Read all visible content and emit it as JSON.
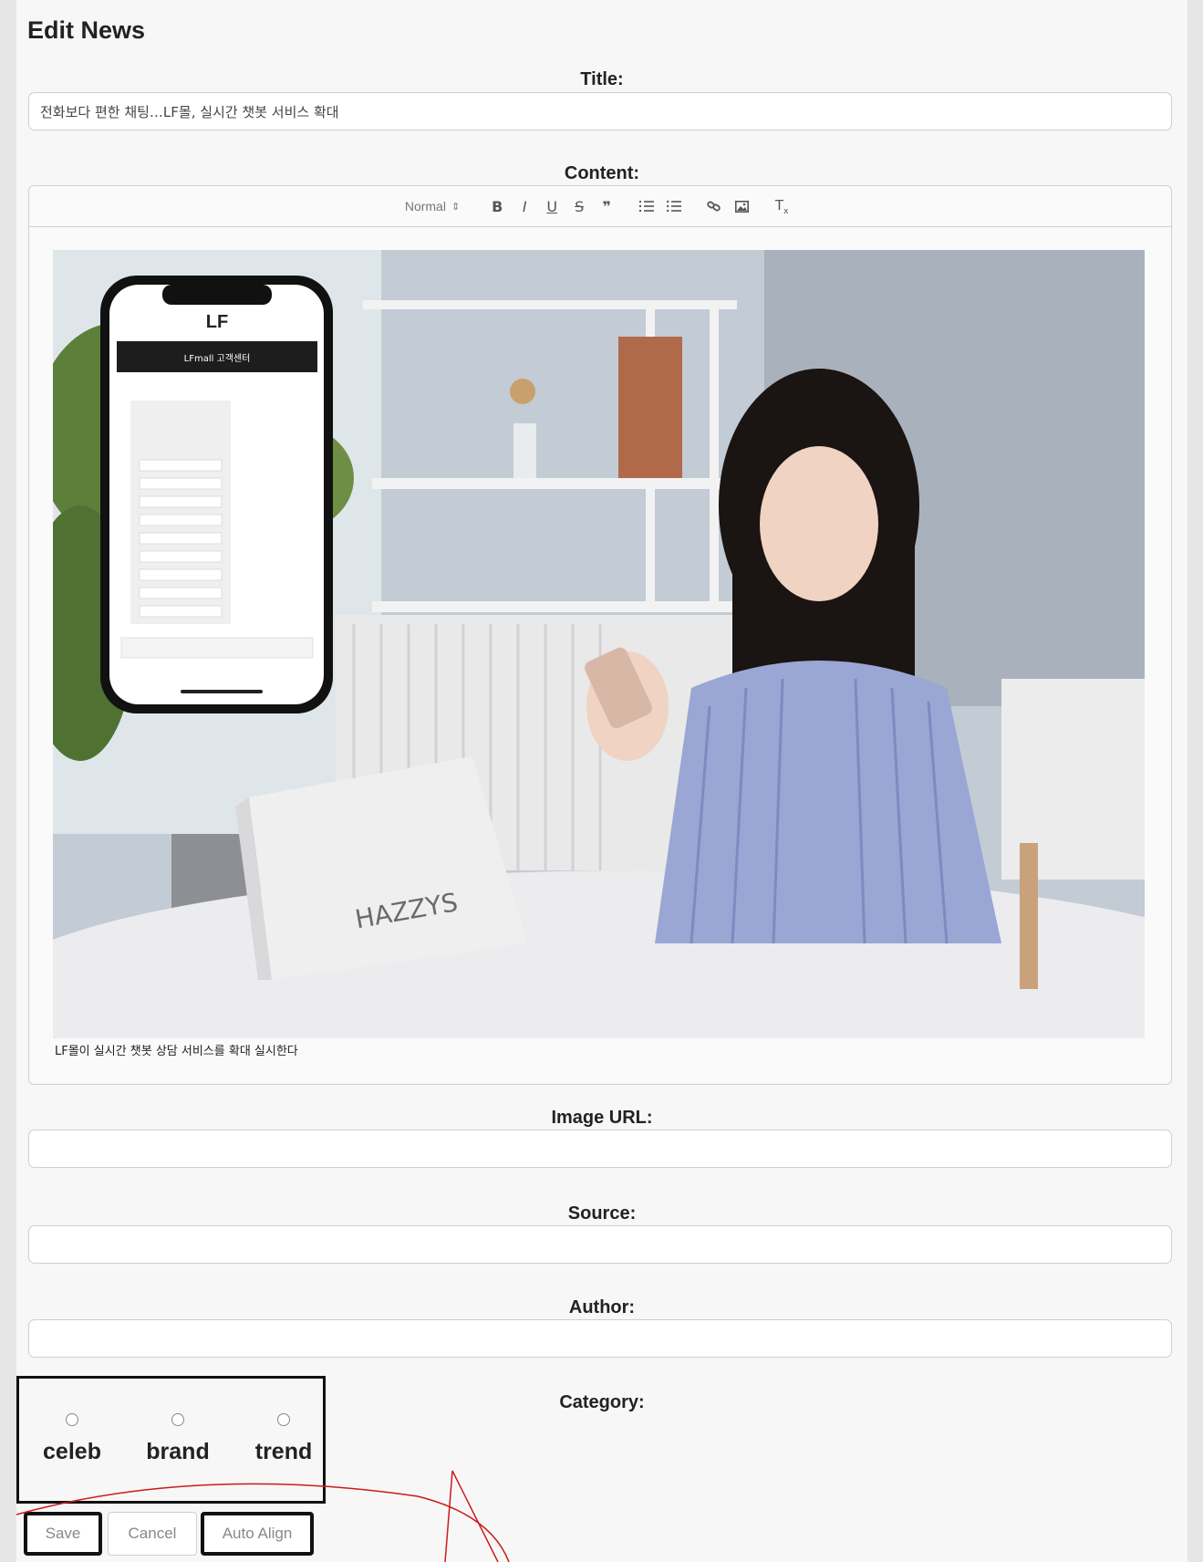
{
  "page": {
    "title": "Edit News"
  },
  "title_field": {
    "label": "Title:",
    "value": "전화보다 편한 채팅…LF몰, 실시간 챗봇 서비스 확대"
  },
  "content_field": {
    "label": "Content:",
    "toolbar": {
      "format_select": "Normal",
      "buttons": [
        {
          "name": "bold-button",
          "glyph": "B",
          "icon": "bold-icon"
        },
        {
          "name": "italic-button",
          "glyph": "I",
          "icon": "italic-icon"
        },
        {
          "name": "underline-button",
          "glyph": "U",
          "icon": "underline-icon"
        },
        {
          "name": "strike-button",
          "glyph": "S",
          "icon": "strikethrough-icon"
        },
        {
          "name": "blockquote-button",
          "glyph": "❞",
          "icon": "quote-icon"
        },
        {
          "name": "ordered-list-button",
          "glyph": "☰",
          "icon": "ordered-list-icon"
        },
        {
          "name": "bullet-list-button",
          "glyph": "☰",
          "icon": "bullet-list-icon"
        },
        {
          "name": "link-button",
          "glyph": "🔗",
          "icon": "link-icon"
        },
        {
          "name": "image-button",
          "glyph": "▣",
          "icon": "image-icon"
        },
        {
          "name": "clear-format-button",
          "glyph": "Tx",
          "icon": "clear-format-icon"
        }
      ]
    },
    "image": {
      "phone_logo": "LF",
      "bag_brand": "HAZZYS",
      "phone_header": "LFmall 고객센터"
    },
    "caption": "LF몰이 실시간 챗봇 상담 서비스를 확대 실시한다"
  },
  "image_url_field": {
    "label": "Image URL:",
    "value": ""
  },
  "source_field": {
    "label": "Source:",
    "value": ""
  },
  "author_field": {
    "label": "Author:",
    "value": ""
  },
  "category_field": {
    "label": "Category:",
    "options": [
      "celeb",
      "brand",
      "trend"
    ]
  },
  "actions": {
    "save_label": "Save",
    "cancel_label": "Cancel",
    "auto_align_label": "Auto Align"
  },
  "colors": {
    "page_bg": "#f7f7f7",
    "border": "#cfcfcf",
    "highlight_box": "#111111",
    "annotation_red": "#cc1a1a"
  }
}
